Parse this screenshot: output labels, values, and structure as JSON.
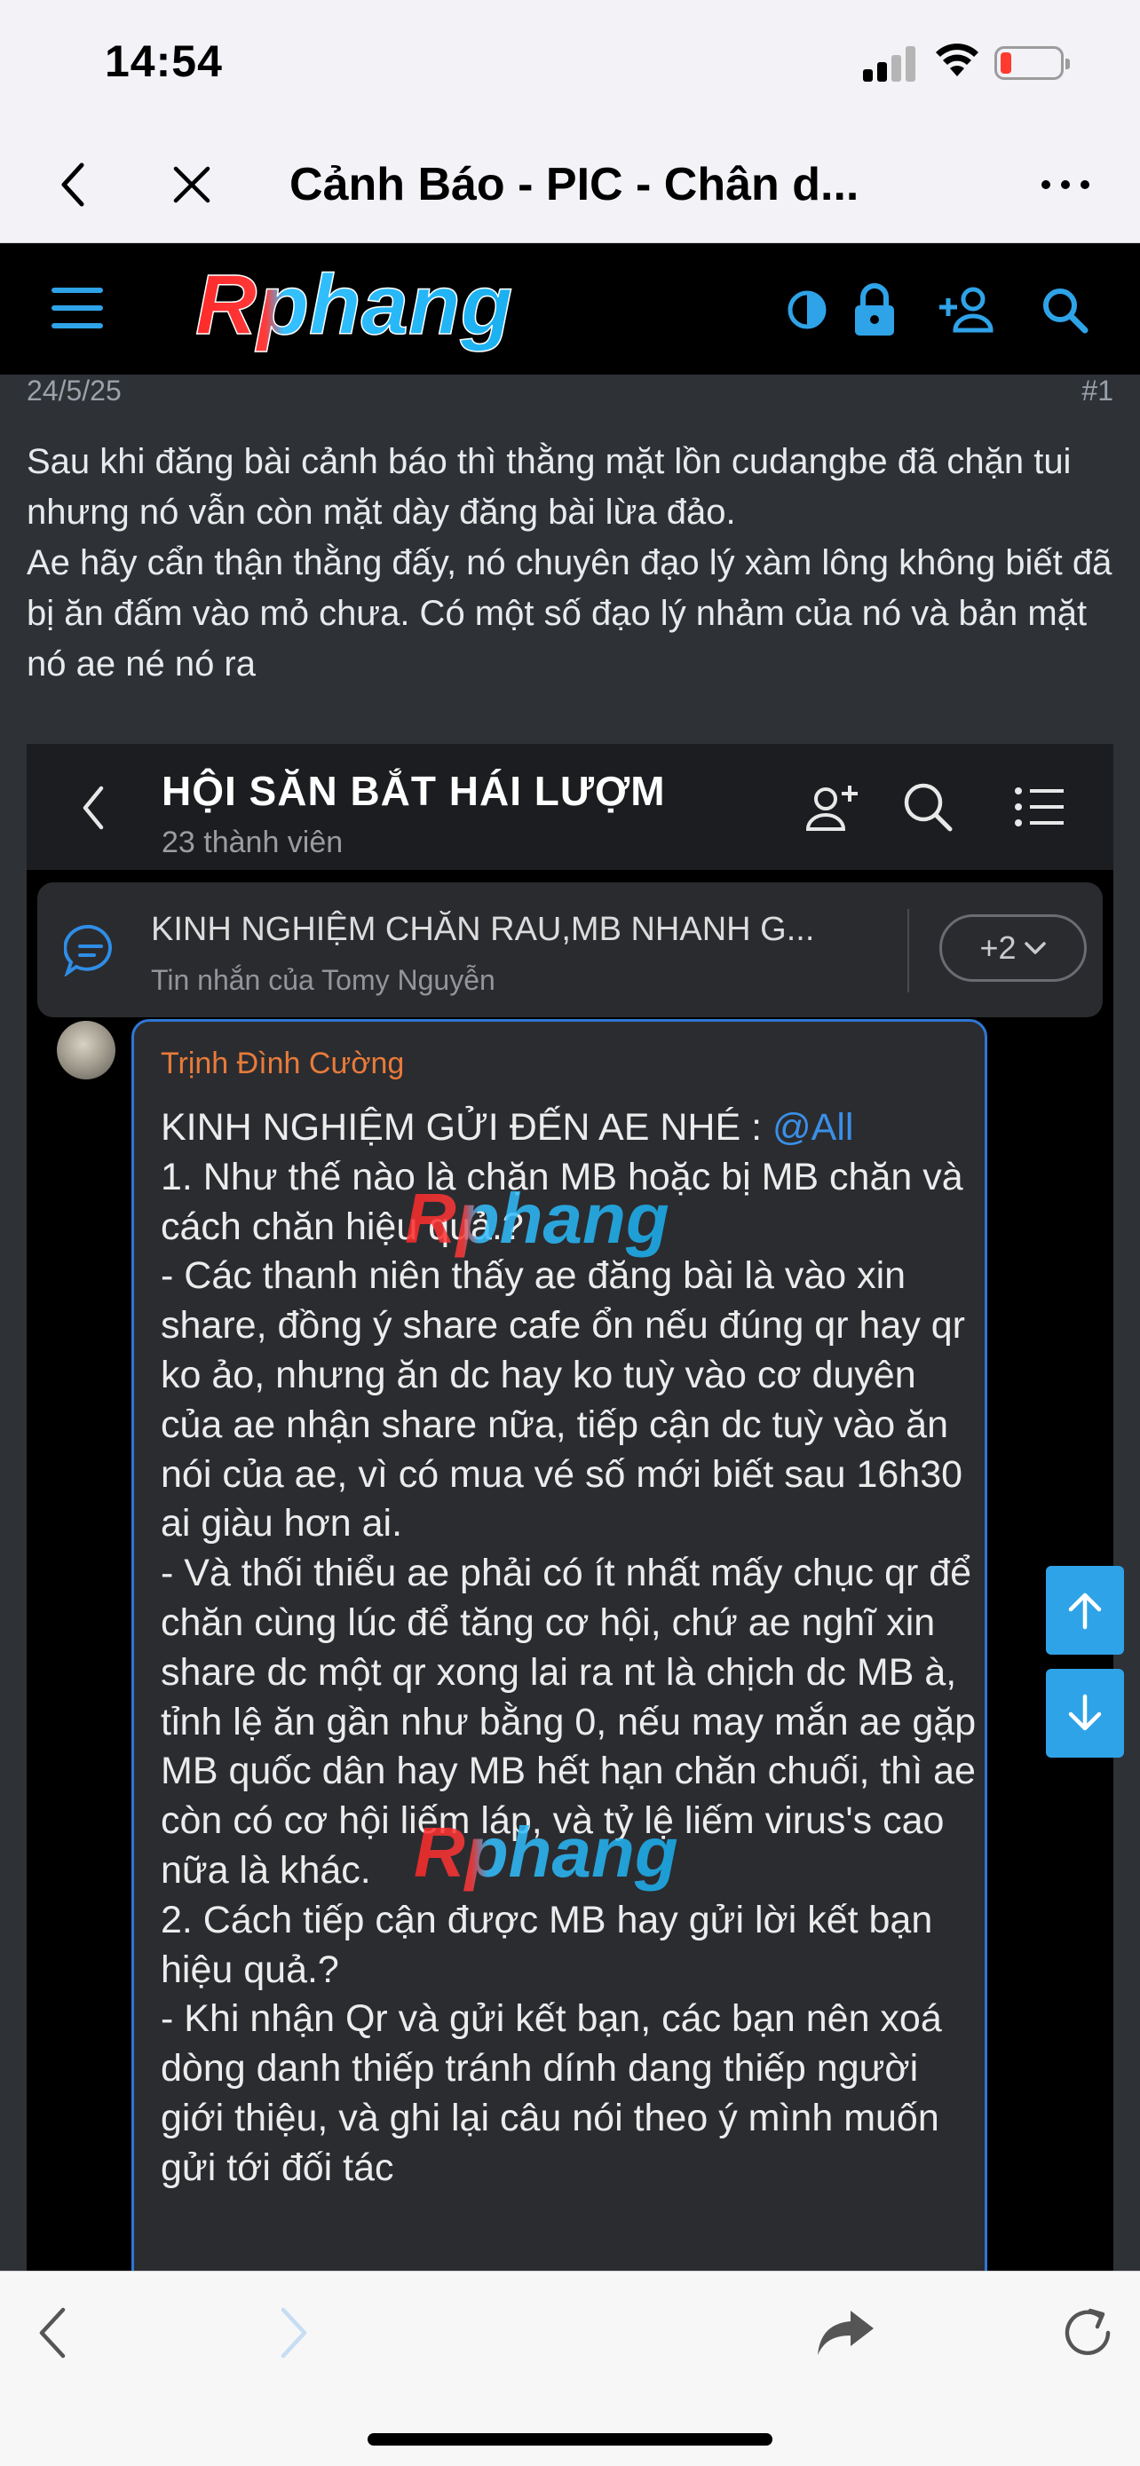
{
  "status_bar": {
    "time": "14:54",
    "battery_level": 0.12
  },
  "browser": {
    "title": "Cảnh Báo - PIC - Chân d..."
  },
  "forum": {
    "logo_text": "Rphang",
    "accent": "#2fa3e8"
  },
  "post": {
    "date": "24/5/25",
    "number": "#1",
    "paragraphs": [
      "Sau khi đăng bài cảnh báo thì thằng mặt lồn cudangbe đã chặn tui nhưng nó vẫn còn mặt dày đăng bài lừa đảo.",
      "Ae hãy cẩn thận thằng đấy, nó chuyên đạo lý xàm lông không biết đã bị ăn đấm vào mỏ chưa. Có một số đạo lý nhảm của nó và bản mặt nó ae né nó ra"
    ]
  },
  "embed": {
    "group_name": "HỘI SĂN BẮT HÁI LƯỢM",
    "members": "23 thành viên",
    "pinned_title": "KINH NGHIỆM CHĂN RAU,MB NHANH G...",
    "pinned_sub": "Tin nhắn của Tomy Nguyễn",
    "pinned_more": "+2",
    "sender": "Trịnh Đình Cường",
    "message_intro": "KINH NGHIỆM GỬI ĐẾN AE NHÉ : ",
    "mention": "@All",
    "message_body": "1. Như thế nào là chặn MB hoặc bị MB chăn và cách chăn hiệu quả.?\n- Các thanh niên thấy ae đăng bài là vào xin share, đồng ý share cafe ổn nếu đúng qr hay qr ko ảo, nhưng ăn dc hay ko tuỳ vào cơ duyên của ae nhận share nữa, tiếp cận dc tuỳ vào ăn nói của ae, vì có mua vé số mới biết sau 16h30 ai giàu hơn ai.\n- Và thối thiểu ae phải có ít nhất mấy chục qr để chăn cùng lúc để tăng cơ hội, chứ ae nghĩ xin share dc một qr xong lai ra nt là chịch dc MB à, tỉnh lệ ăn gần như bằng 0, nếu may mắn ae gặp MB quốc dân hay MB hết hạn chăn chuối, thì ae còn có cơ hội liếm láp, và tỷ lệ liếm virus's cao nữa là khác.\n2. Cách tiếp cận được MB hay gửi lời kết bạn hiệu quả.?\n- Khi nhận Qr và gửi kết bạn, các bạn nên xoá dòng danh thiếp tránh dính dang thiếp người giới thiệu, và ghi lại câu nói theo ý mình muốn gửi tới đối tác"
  }
}
